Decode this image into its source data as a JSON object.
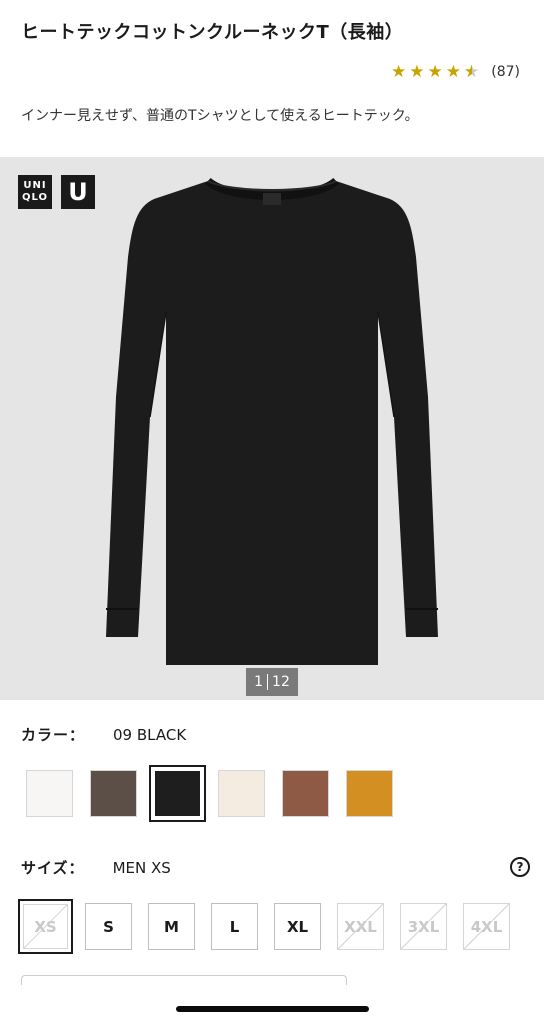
{
  "product": {
    "title": "ヒートテックコットンクルーネックT（長袖）",
    "rating": 4.5,
    "review_count": "(87)",
    "description": "インナー見えせず、普通のTシャツとして使えるヒートテック。"
  },
  "gallery": {
    "brand_logo_line1": "UNI",
    "brand_logo_line2": "QLO",
    "brand_u": "U",
    "page_current": "1",
    "page_total": "12"
  },
  "color": {
    "label": "カラー：",
    "value": "09 BLACK",
    "swatches": [
      "#f7f6f5",
      "#5c4f47",
      "#1e1e1e",
      "#f4ece1",
      "#8e5a45",
      "#d48f22"
    ],
    "selected_index": 2
  },
  "size": {
    "label": "サイズ：",
    "value": "MEN XS",
    "help": "?",
    "options": [
      "XS",
      "S",
      "M",
      "L",
      "XL",
      "XXL",
      "3XL",
      "4XL"
    ]
  }
}
